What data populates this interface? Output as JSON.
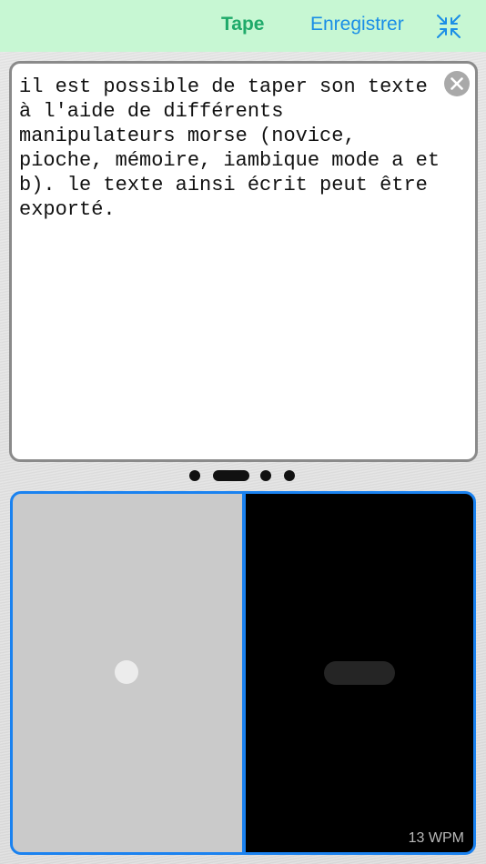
{
  "toolbar": {
    "tab_label": "Tape",
    "save_label": "Enregistrer",
    "collapse_icon": "collapse-arrows-icon",
    "colors": {
      "background": "#c7f7d3",
      "tab": "#1faa6a",
      "link": "#1a8ee6"
    }
  },
  "editor": {
    "text": "il est possible de taper son texte\nà l'aide de différents\nmanipulateurs morse (novice,\npioche, mémoire, iambique mode a et\nb). le texte ainsi écrit peut être\nexporté.",
    "clear_icon": "clear-x-icon"
  },
  "pager": {
    "items": [
      "dot",
      "dash",
      "dot",
      "dot"
    ],
    "current_index": 1
  },
  "keyer": {
    "left_paddle": {
      "symbol": "dit"
    },
    "right_paddle": {
      "symbol": "dah"
    },
    "speed": "13 WPM",
    "accent_color": "#1a82f0"
  }
}
